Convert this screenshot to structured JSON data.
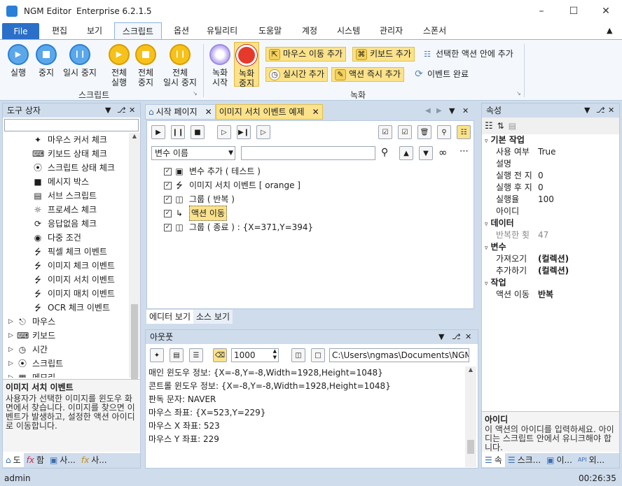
{
  "window": {
    "app": "NGM Editor",
    "edition": "Enterprise 6.2.1.5"
  },
  "menu": {
    "file": "File",
    "items": [
      "편집",
      "보기",
      "스크립트",
      "옵션",
      "유틸리티",
      "도움말",
      "계정",
      "시스템",
      "관리자",
      "스폰서"
    ],
    "active": "스크립트"
  },
  "ribbon": {
    "run": "실행",
    "stop": "중지",
    "pause": "일시 중지",
    "run_all_1": "전체",
    "run_all_2": "실행",
    "stop_all_1": "전체",
    "stop_all_2": "중지",
    "pause_all_1": "전체",
    "pause_all_2": "일시 중지",
    "script_group": "스크립트",
    "rec_start_1": "녹화",
    "rec_start_2": "시작",
    "rec_stop_1": "녹화",
    "rec_stop_2": "중지",
    "add_mouse": "마우스 이동 추가",
    "add_keyboard": "키보드 추가",
    "in_selected": "선택한 액션 안에 추가",
    "add_realtime": "실시간 추가",
    "add_action_now": "액션 즉시 추가",
    "event_done": "이벤트 완료",
    "record_group": "녹화"
  },
  "toolbox": {
    "title": "도구 상자",
    "items": [
      "마우스 커서 체크",
      "키보드 상태 체크",
      "스크립트 상태 체크",
      "메시지 박스",
      "서브 스크립트",
      "프로세스 체크",
      "응답없음 체크",
      "다중 조건",
      "픽셀 체크 이벤트",
      "이미지 체크 이벤트",
      "이미지 서치 이벤트",
      "이미지 매치 이벤트",
      "OCR 체크 이벤트"
    ],
    "categories": [
      "마우스",
      "키보드",
      "시간",
      "스크립트",
      "메모리"
    ],
    "desc_title": "이미지 서치 이벤트",
    "desc": "사용자가 선택한 이미지를 윈도우 화면에서 찾습니다. 이미지를 찾으면 이벤트가 발생하고, 설정한 액션 아이디로 이동합니다.",
    "tabs": [
      "도",
      "함",
      "사...",
      "사..."
    ]
  },
  "editor": {
    "tabs": [
      "시작 페이지",
      "이미지 서치 이벤트 예제"
    ],
    "var_select": "변수 이름",
    "var_value": "",
    "tree": [
      {
        "label": "변수 추가 ( 테스트 )",
        "icon": "cube-icon"
      },
      {
        "label": "이미지 서치 이벤트 [ orange ]",
        "icon": "bolt-icon"
      },
      {
        "label": "그룹 ( 반복 )",
        "icon": "group-icon"
      },
      {
        "label": "액션 이동",
        "icon": "jump-icon"
      },
      {
        "label": "그룹 ( 종료 ) : {X=371,Y=394}",
        "icon": "group-icon"
      }
    ],
    "bottom_tabs": [
      "에디터 보기",
      "소스 보기"
    ]
  },
  "output": {
    "title": "아웃풋",
    "count": "1000",
    "path": "C:\\Users\\ngmas\\Documents\\NGM6\\",
    "lines": [
      "매인 윈도우 정보: {X=-8,Y=-8,Width=1928,Height=1048}",
      "콘트롤 윈도우 정보: {X=-8,Y=-8,Width=1928,Height=1048}",
      "판독 문자: NAVER",
      "마우스 좌표: {X=523,Y=229}",
      "마우스 X 좌표: 523",
      "마우스 Y 좌표: 229"
    ]
  },
  "props": {
    "title": "속성",
    "cat_basic": "기본 작업",
    "basic": [
      [
        "사용 여부",
        "True"
      ],
      [
        "설명",
        ""
      ],
      [
        "실행 전 지",
        "0"
      ],
      [
        "실행 후 지",
        "0"
      ],
      [
        "실행율",
        "100"
      ],
      [
        "아이디",
        ""
      ]
    ],
    "cat_data": "데이터",
    "data": [
      [
        "반복한 횟",
        "47"
      ]
    ],
    "cat_var": "변수",
    "var": [
      [
        "가져오기",
        "(컬렉션)"
      ],
      [
        "추가하기",
        "(컬렉션)"
      ]
    ],
    "cat_work": "작업",
    "work": [
      [
        "액션 이동",
        "반복"
      ]
    ],
    "desc_title": "아이디",
    "desc": "이 액션의 아이디를 입력하세요. 아이디는 스크립트 안에서 유니크해야 합니다.",
    "tabs": [
      "속",
      "스크...",
      "이...",
      "외..."
    ]
  },
  "status": {
    "user": "admin",
    "time": "00:26:35"
  },
  "colors": {
    "accent": "#2b6fc9",
    "highlight": "#fbe28b"
  }
}
